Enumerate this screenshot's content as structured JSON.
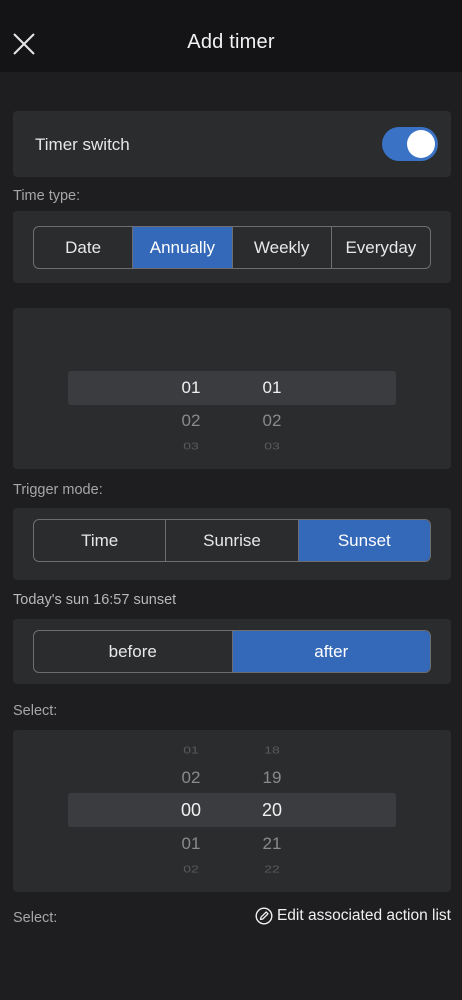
{
  "header": {
    "title": "Add timer",
    "close_icon": "close-icon"
  },
  "timer_switch": {
    "label": "Timer switch",
    "on": true,
    "accent": "#3a72c6"
  },
  "time_type": {
    "label": "Time type:",
    "options": [
      "Date",
      "Annually",
      "Weekly",
      "Everyday"
    ],
    "selected": "Annually"
  },
  "date_picker": {
    "month": [
      "01",
      "02",
      "03"
    ],
    "day": [
      "01",
      "02",
      "03"
    ]
  },
  "trigger_mode": {
    "label": "Trigger mode:",
    "options": [
      "Time",
      "Sunrise",
      "Sunset"
    ],
    "selected": "Sunset"
  },
  "sun_info": "Today's sun 16:57 sunset",
  "offset": {
    "options": [
      "before",
      "after"
    ],
    "selected": "after"
  },
  "offset_picker": {
    "label": "Select:",
    "hours": [
      "01",
      "02",
      "00",
      "01",
      "02"
    ],
    "minutes": [
      "18",
      "19",
      "20",
      "21",
      "22"
    ]
  },
  "footer": {
    "label": "Select:",
    "edit_link": "Edit associated action list",
    "edit_icon": "edit-icon"
  }
}
